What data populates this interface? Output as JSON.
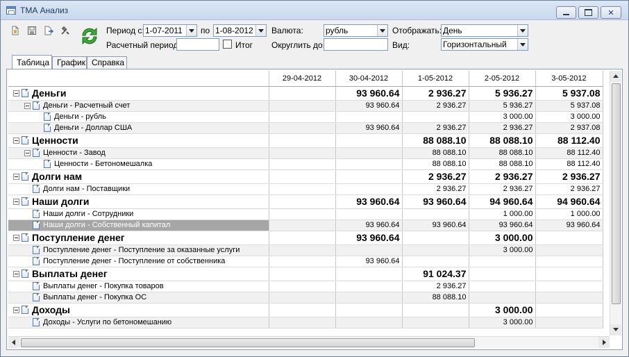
{
  "window": {
    "title": "ТМА Анализ"
  },
  "toolbar": {
    "period_from_label": "Период с:",
    "period_from_value": "1-07-2011",
    "period_to_label": "по",
    "period_to_value": "1-08-2012",
    "currency_label": "Валюта:",
    "currency_value": "рубль",
    "display_label": "Отображать:",
    "display_value": "День",
    "calc_period_label": "Расчетный период:",
    "calc_period_value": "",
    "total_label": "Итог",
    "total_checked": false,
    "round_label": "Округлить до:",
    "round_value": "",
    "view_label": "Вид:",
    "view_value": "Горизонтальный"
  },
  "tabs": [
    {
      "label": "Таблица",
      "active": true
    },
    {
      "label": "График",
      "active": false
    },
    {
      "label": "Справка",
      "active": false
    }
  ],
  "grid": {
    "columns": [
      "",
      "29-04-2012",
      "30-04-2012",
      "1-05-2012",
      "2-05-2012",
      "3-05-2012"
    ],
    "rows": [
      {
        "level": 0,
        "label": "Деньги",
        "values": [
          "",
          "93 960.64",
          "2 936.27",
          "5 936.27",
          "5 937.08"
        ],
        "expandable": true
      },
      {
        "level": 1,
        "label": "Деньги - Расчетный счет",
        "values": [
          "",
          "93 960.64",
          "2 936.27",
          "5 936.27",
          "5 937.08"
        ],
        "expandable": true
      },
      {
        "level": 2,
        "label": "Деньги - рубль",
        "values": [
          "",
          "",
          "",
          "3 000.00",
          "3 000.00"
        ]
      },
      {
        "level": 2,
        "label": "Деньги - Доллар США",
        "values": [
          "",
          "93 960.64",
          "2 936.27",
          "2 936.27",
          "2 937.08"
        ]
      },
      {
        "level": 0,
        "label": "Ценности",
        "values": [
          "",
          "",
          "88 088.10",
          "88 088.10",
          "88 112.40"
        ],
        "expandable": true
      },
      {
        "level": 1,
        "label": "Ценности - Завод",
        "values": [
          "",
          "",
          "88 088.10",
          "88 088.10",
          "88 112.40"
        ],
        "expandable": true
      },
      {
        "level": 2,
        "label": "Ценности - Бетономешалка",
        "values": [
          "",
          "",
          "88 088.10",
          "88 088.10",
          "88 112.40"
        ]
      },
      {
        "level": 0,
        "label": "Долги нам",
        "values": [
          "",
          "",
          "2 936.27",
          "2 936.27",
          "2 936.27"
        ],
        "expandable": true
      },
      {
        "level": 1,
        "label": "Долги нам - Поставщики",
        "values": [
          "",
          "",
          "2 936.27",
          "2 936.27",
          "2 936.27"
        ]
      },
      {
        "level": 0,
        "label": "Наши долги",
        "values": [
          "",
          "93 960.64",
          "93 960.64",
          "94 960.64",
          "94 960.64"
        ],
        "expandable": true
      },
      {
        "level": 1,
        "label": "Наши долги - Сотрудники",
        "values": [
          "",
          "",
          "",
          "1 000.00",
          "1 000.00"
        ]
      },
      {
        "level": 1,
        "label": "Наши долги - Собственный капитал",
        "values": [
          "",
          "93 960.64",
          "93 960.64",
          "93 960.64",
          "93 960.64"
        ],
        "selected": true
      },
      {
        "level": 0,
        "label": "Поступление денег",
        "values": [
          "",
          "93 960.64",
          "",
          "3 000.00",
          ""
        ],
        "expandable": true
      },
      {
        "level": 1,
        "label": "Поступление денег - Поступление за оказанные услуги",
        "values": [
          "",
          "",
          "",
          "3 000.00",
          ""
        ]
      },
      {
        "level": 1,
        "label": "Поступление денег - Поступление от собственника",
        "values": [
          "",
          "93 960.64",
          "",
          "",
          ""
        ]
      },
      {
        "level": 0,
        "label": "Выплаты денег",
        "values": [
          "",
          "",
          "91 024.37",
          "",
          ""
        ],
        "expandable": true
      },
      {
        "level": 1,
        "label": "Выплаты денег - Покупка товаров",
        "values": [
          "",
          "",
          "2 936.27",
          "",
          ""
        ]
      },
      {
        "level": 1,
        "label": "Выплаты денег - Покупка ОС",
        "values": [
          "",
          "",
          "88 088.10",
          "",
          ""
        ]
      },
      {
        "level": 0,
        "label": "Доходы",
        "values": [
          "",
          "",
          "",
          "3 000.00",
          ""
        ],
        "expandable": true
      },
      {
        "level": 1,
        "label": "Доходы - Услуги по бетономешанию",
        "values": [
          "",
          "",
          "",
          "3 000.00",
          ""
        ]
      }
    ]
  }
}
